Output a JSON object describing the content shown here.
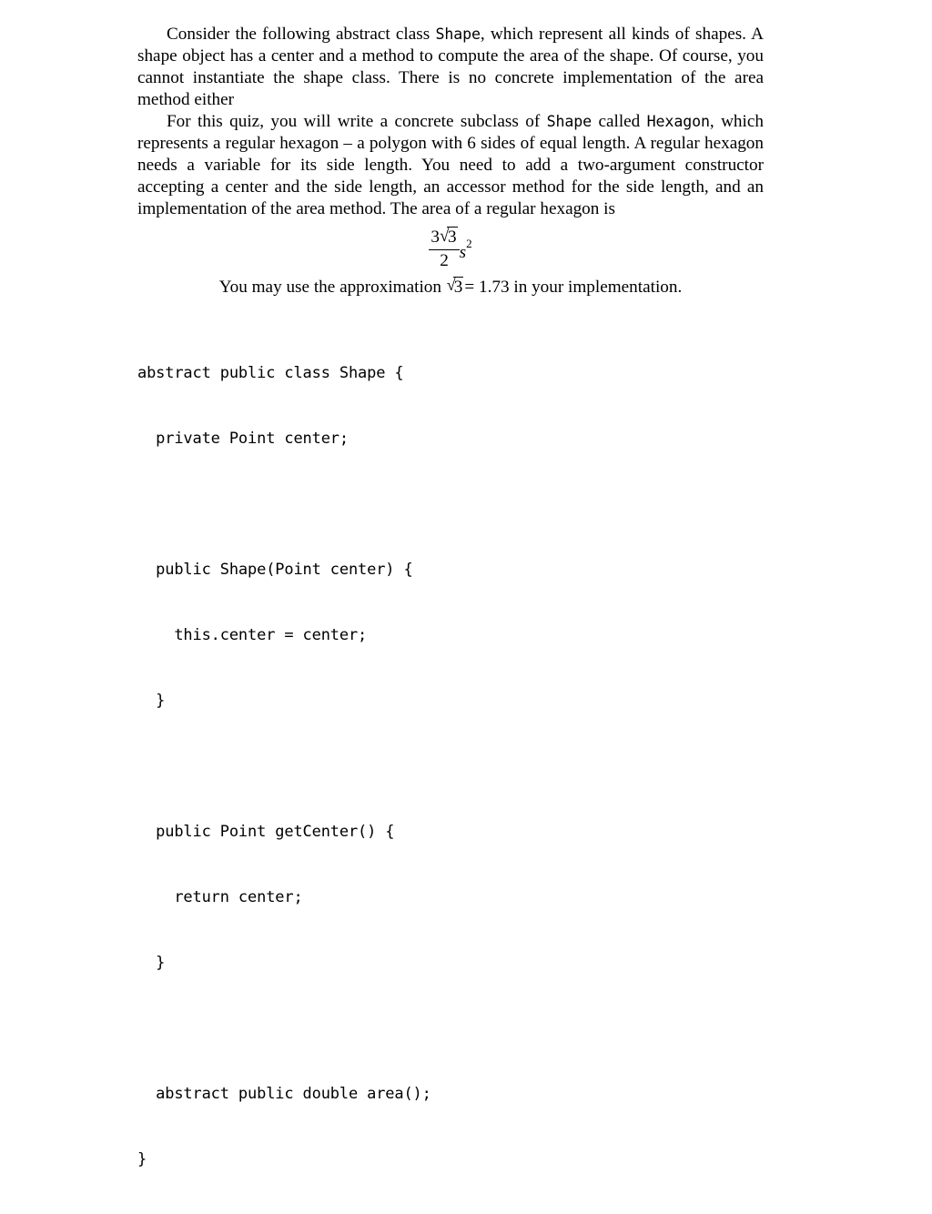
{
  "document": {
    "paragraphs": [
      {
        "id": "intro",
        "runs": [
          {
            "type": "text",
            "text": "Consider the following abstract class "
          },
          {
            "type": "code",
            "text": "Shape"
          },
          {
            "type": "text",
            "text": ", which represent all kinds of shapes. A shape object has a center and a method to compute the area of the shape. Of course, you cannot instantiate the shape class. There is no concrete implementation of the area method either"
          }
        ],
        "plain": "Consider the following abstract class Shape, which represent all kinds of shapes. A shape object has a center and a method to compute the area of the shape. Of course, you cannot instantiate the shape class. There is no concrete implementation of the area method either"
      },
      {
        "id": "task",
        "runs": [
          {
            "type": "text",
            "text": "For this quiz, you will write a concrete subclass of "
          },
          {
            "type": "code",
            "text": "Shape"
          },
          {
            "type": "text",
            "text": " called "
          },
          {
            "type": "code",
            "text": "Hexagon"
          },
          {
            "type": "text",
            "text": ", which represents a regular hexagon – a polygon with 6 sides of equal length. A regular hexagon needs a variable for its side length. You need to add a two-argument constructor accepting a center and the side length, an accessor method for the side length, and an implementation of the area method. The area of a regular hexagon is"
          }
        ],
        "plain": "For this quiz, you will write a concrete subclass of Shape called Hexagon, which represents a regular hexagon – a polygon with 6 sides of equal length. A regular hexagon needs a variable for its side length. You need to add a two-argument constructor accepting a center and the side length, an accessor method for the side length, and an implementation of the area method. The area of a regular hexagon is"
      }
    ],
    "formula": {
      "latex": "\\frac{3\\sqrt{3}}{2}s^2",
      "numerator_coefficient": "3",
      "numerator_radicand": "3",
      "denominator": "2",
      "variable": "s",
      "exponent": "2",
      "radical_glyph": "√"
    },
    "approximation": {
      "prefix": "You may use the approximation ",
      "radical_glyph": "√",
      "radicand": "3",
      "equals": "=",
      "value": "1.73",
      "suffix": " in your implementation."
    },
    "code_listing": {
      "language": "java",
      "lines": [
        "abstract public class Shape {",
        "  private Point center;",
        "",
        "  public Shape(Point center) {",
        "    this.center = center;",
        "  }",
        "",
        "  public Point getCenter() {",
        "    return center;",
        "  }",
        "",
        "  abstract public double area();",
        "}"
      ]
    },
    "colors": {
      "background": "#ffffff",
      "text": "#000000"
    }
  }
}
